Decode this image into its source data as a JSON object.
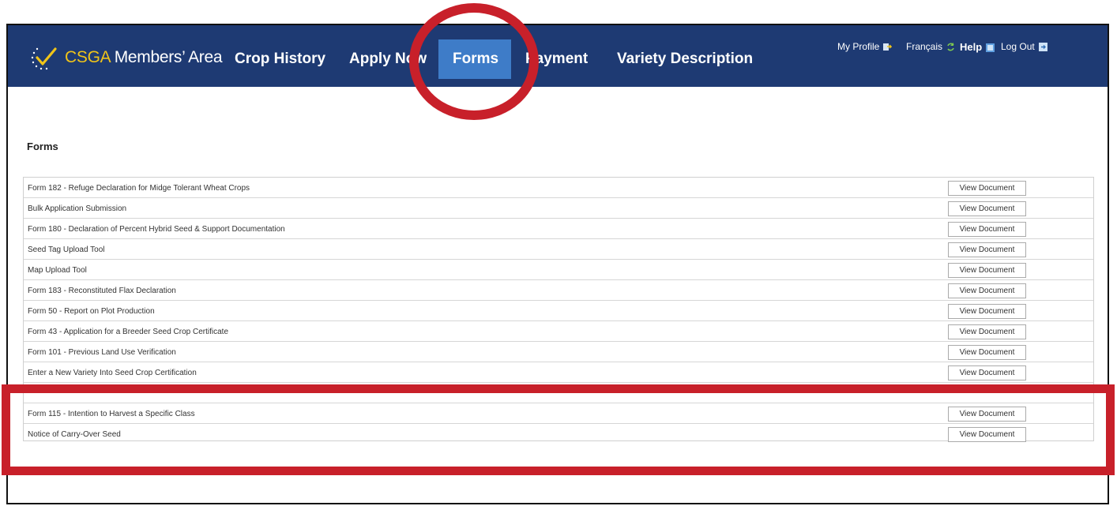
{
  "header": {
    "logo_brand": "CSGA",
    "logo_rest": " Members’ Area",
    "nav": [
      {
        "label": "Crop History"
      },
      {
        "label": "Apply Now"
      },
      {
        "label": "Forms"
      },
      {
        "label": "Payment"
      },
      {
        "label": "Variety Description"
      }
    ],
    "utility": {
      "profile": "My Profile",
      "language": "Français",
      "help": "Help",
      "logout": "Log Out"
    }
  },
  "main": {
    "title": "Forms",
    "rows": [
      {
        "label": "Form 182 - Refuge Declaration for Midge Tolerant Wheat Crops",
        "button": "View Document"
      },
      {
        "label": "Bulk Application Submission",
        "button": "View Document"
      },
      {
        "label": "Form 180 - Declaration of Percent Hybrid Seed & Support Documentation",
        "button": "View Document"
      },
      {
        "label": "Seed Tag Upload Tool",
        "button": "View Document"
      },
      {
        "label": "Map Upload Tool",
        "button": "View Document"
      },
      {
        "label": "Form 183 - Reconstituted Flax Declaration",
        "button": "View Document"
      },
      {
        "label": "Form 50 - Report on Plot Production",
        "button": "View Document"
      },
      {
        "label": "Form 43 - Application for a Breeder Seed Crop Certificate",
        "button": "View Document"
      },
      {
        "label": "Form 101 - Previous Land Use Verification",
        "button": "View Document"
      },
      {
        "label": "Enter a New Variety Into Seed Crop Certification",
        "button": "View Document"
      },
      {
        "label": "",
        "button": ""
      },
      {
        "label": "Form 115 - Intention to Harvest a Specific Class",
        "button": "View Document"
      },
      {
        "label": "Notice of Carry-Over Seed",
        "button": "View Document"
      }
    ]
  },
  "colors": {
    "nav_bg": "#1e3a73",
    "nav_active": "#3e7cc8",
    "annotation_red": "#c8202a",
    "logo_accent": "#f0c419"
  },
  "icons": [
    "checkmark-logo-icon",
    "profile-icon",
    "refresh-icon",
    "help-icon",
    "logout-icon"
  ]
}
